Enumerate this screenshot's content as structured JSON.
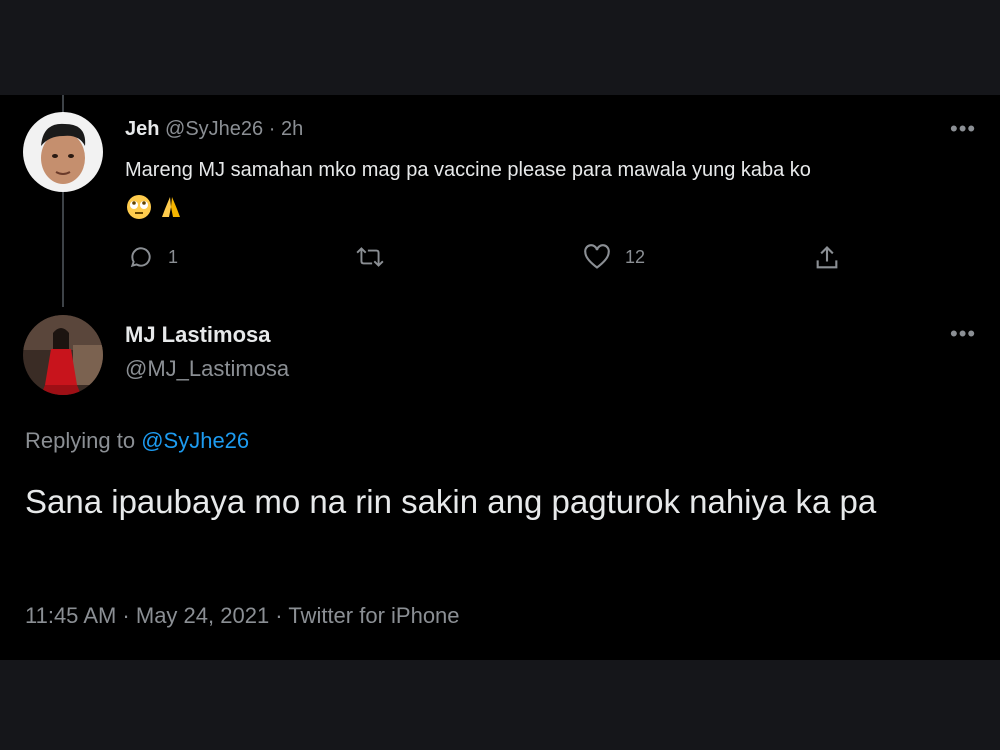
{
  "reply": {
    "display_name": "Jeh",
    "handle": "@SyJhe26",
    "time": "· 2h",
    "text": "Mareng MJ samahan mko mag pa vaccine please para mawala yung kaba ko",
    "emojis": [
      "rolling-eyes-emoji",
      "folded-hands-emoji"
    ],
    "reply_count": "1",
    "like_count": "12"
  },
  "main": {
    "display_name": "MJ Lastimosa",
    "handle": "@MJ_Lastimosa",
    "replying_prefix": "Replying to",
    "replying_to": "@SyJhe26",
    "text": "Sana ipaubaya mo na rin sakin ang pagturok nahiya ka pa",
    "timestamp": "11:45 AM · May 24, 2021 · Twitter for iPhone"
  },
  "more_label": "•••",
  "colors": {
    "background": "#000000",
    "outer": "#15161a",
    "text": "#e7e9ea",
    "muted": "#8b8f94",
    "accent": "#1d9bf0"
  }
}
